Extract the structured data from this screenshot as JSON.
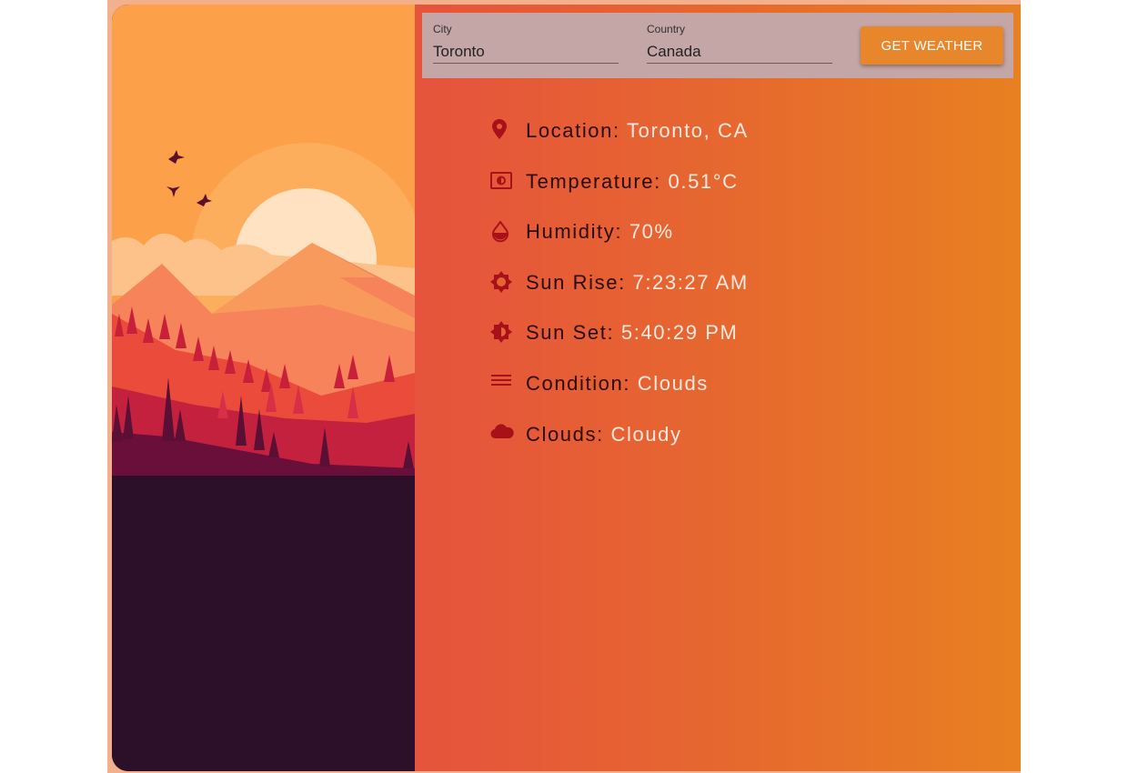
{
  "form": {
    "city_label": "City",
    "city_value": "Toronto",
    "country_label": "Country",
    "country_value": "Canada",
    "submit_label": "GET WEATHER"
  },
  "weather": {
    "location": {
      "label": "Location:",
      "value": "Toronto, CA",
      "icon": "map-pin-icon"
    },
    "temperature": {
      "label": "Temperature:",
      "value": "0.51°C",
      "icon": "thermometer-icon"
    },
    "humidity": {
      "label": "Humidity:",
      "value": "70%",
      "icon": "water-drop-icon"
    },
    "sunrise": {
      "label": "Sun Rise:",
      "value": "7:23:27 AM",
      "icon": "sun-icon"
    },
    "sunset": {
      "label": "Sun Set:",
      "value": "5:40:29 PM",
      "icon": "half-sun-icon"
    },
    "condition": {
      "label": "Condition:",
      "value": "Clouds",
      "icon": "lines-icon"
    },
    "clouds": {
      "label": "Clouds:",
      "value": "Cloudy",
      "icon": "cloud-icon"
    }
  },
  "colors": {
    "icon": "#a8101a",
    "label": "#2a0a08",
    "value": "#fbe9df",
    "button": "#e8862b",
    "form_bg": "#c4a6a6",
    "gradient_start": "#e5533c",
    "gradient_end": "#e88021"
  }
}
